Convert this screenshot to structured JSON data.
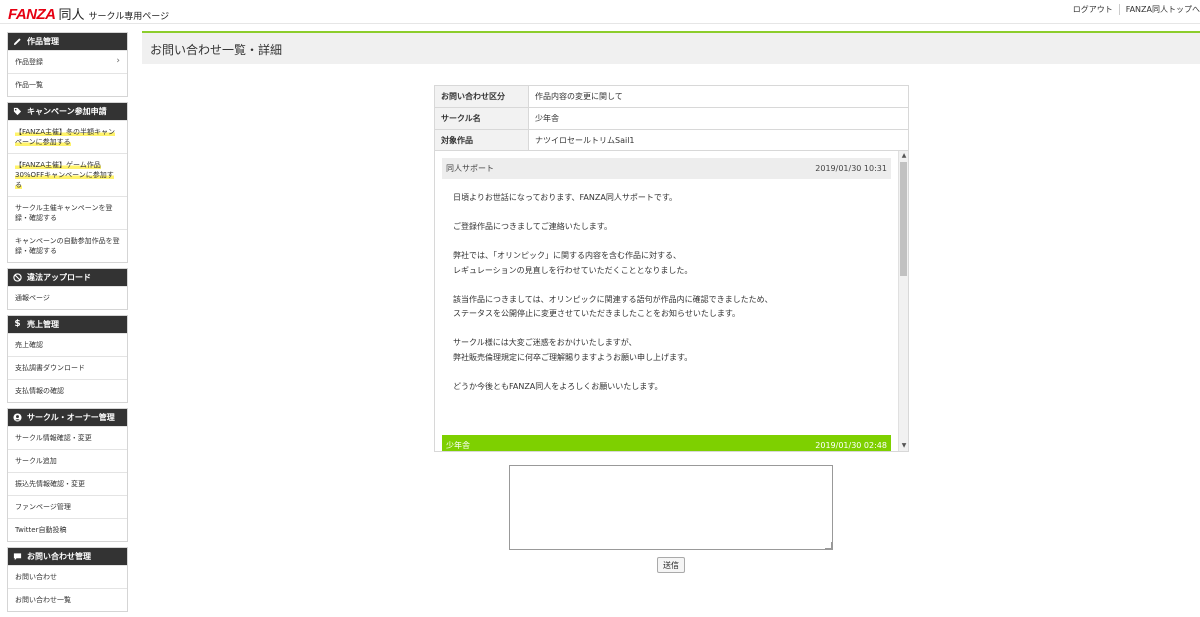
{
  "header": {
    "logo_brand": "FANZA",
    "logo_service": "同人",
    "logo_subtitle": "サークル専用ページ",
    "logout": "ログアウト",
    "top_link": "FANZA同人トップへ"
  },
  "sidebar": {
    "sections": [
      {
        "title": "作品管理",
        "icon": "pencil-icon",
        "items": [
          "作品登録",
          "作品一覧"
        ]
      },
      {
        "title": "キャンペーン参加申請",
        "icon": "tag-icon",
        "items": [
          "【FANZA主催】冬の半額キャンペーンに参加する",
          "【FANZA主催】ゲーム作品30%OFFキャンペーンに参加する",
          "サークル主催キャンペーンを登録・確認する",
          "キャンペーンの自動参加作品を登録・確認する"
        ]
      },
      {
        "title": "違法アップロード",
        "icon": "prohibited-icon",
        "items": [
          "通報ページ"
        ]
      },
      {
        "title": "売上管理",
        "icon": "dollar-icon",
        "items": [
          "売上確認",
          "支払調書ダウンロード",
          "支払情報の確認"
        ]
      },
      {
        "title": "サークル・オーナー管理",
        "icon": "user-circle-icon",
        "items": [
          "サークル情報確認・変更",
          "サークル追加",
          "振込先情報確認・変更",
          "ファンページ管理",
          "Twitter自動投稿"
        ]
      },
      {
        "title": "お問い合わせ管理",
        "icon": "chat-icon",
        "items": [
          "お問い合わせ",
          "お問い合わせ一覧"
        ]
      }
    ]
  },
  "main": {
    "title": "お問い合わせ一覧・詳細",
    "info": [
      {
        "label": "お問い合わせ区分",
        "value": "作品内容の変更に関して"
      },
      {
        "label": "サークル名",
        "value": "少年舎"
      },
      {
        "label": "対象作品",
        "value": "ナツイロセールトリムSail1"
      }
    ],
    "messages": [
      {
        "sender": "同人サポート",
        "timestamp": "2019/01/30 10:31",
        "body": [
          "日頃よりお世話になっております、FANZA同人サポートです。",
          "ご登録作品につきましてご連絡いたします。",
          "弊社では、「オリンピック」に関する内容を含む作品に対する、\nレギュレーションの見直しを行わせていただくこととなりました。",
          "該当作品につきましては、オリンピックに関連する語句が作品内に確認できましたため、\nステータスを公開停止に変更させていただきましたことをお知らせいたします。",
          "サークル様には大変ご迷惑をおかけいたしますが、\n弊社販売倫理規定に何卒ご理解賜りますようお願い申し上げます。",
          "どうか今後ともFANZA同人をよろしくお願いいたします。"
        ]
      },
      {
        "sender": "少年舎",
        "timestamp": "2019/01/30 02:48"
      }
    ],
    "reply_value": "",
    "send_label": "送信"
  }
}
